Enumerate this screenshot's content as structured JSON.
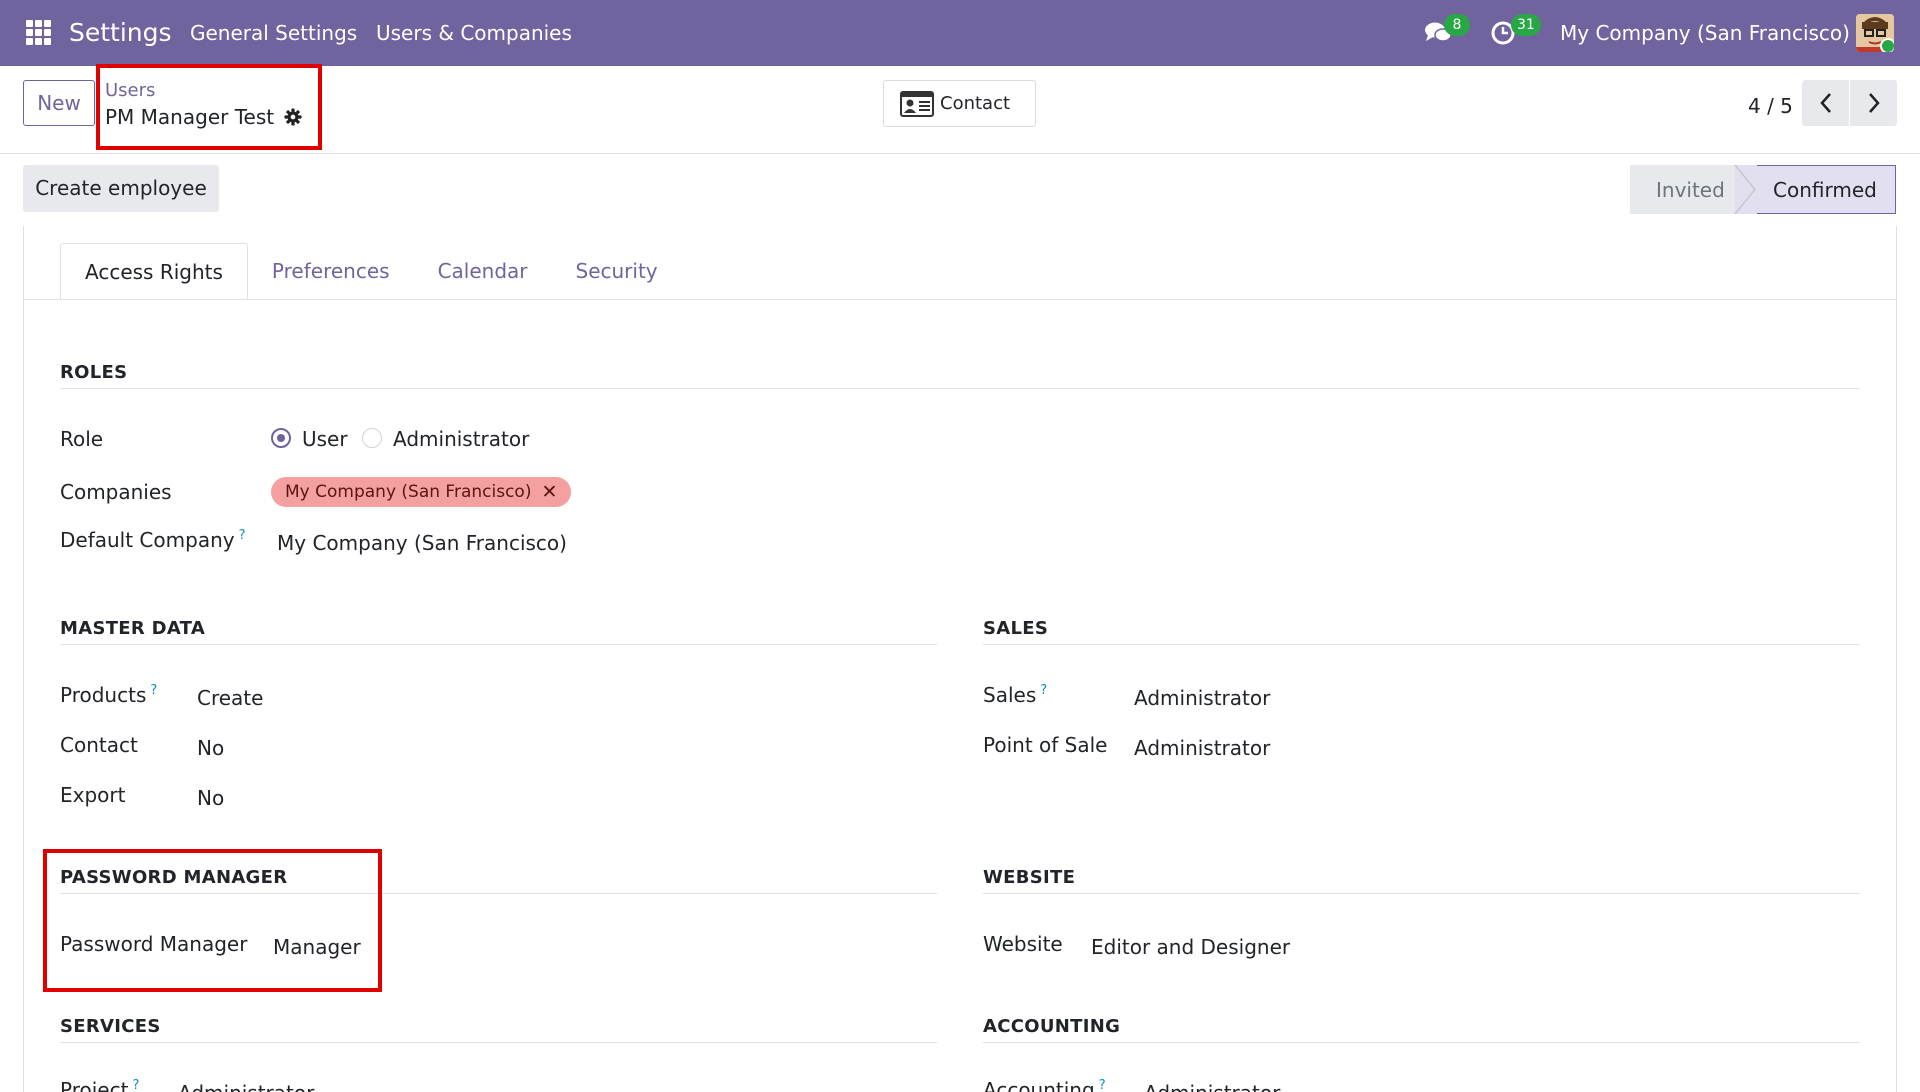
{
  "navbar": {
    "app_title": "Settings",
    "menu": [
      "General Settings",
      "Users & Companies"
    ],
    "messages_count": "8",
    "activities_count": "31",
    "company": "My Company (San Francisco)"
  },
  "control": {
    "new_label": "New",
    "breadcrumb_parent": "Users",
    "breadcrumb_current": "PM Manager Test",
    "contact_label": "Contact",
    "pager": "4 / 5"
  },
  "status": {
    "create_employee_label": "Create employee",
    "stages": [
      "Invited",
      "Confirmed"
    ],
    "active_stage": "Confirmed"
  },
  "tabs": [
    "Access Rights",
    "Preferences",
    "Calendar",
    "Security"
  ],
  "roles": {
    "title": "ROLES",
    "role_label": "Role",
    "role_options": [
      "User",
      "Administrator"
    ],
    "role_selected": "User",
    "companies_label": "Companies",
    "companies_tags": [
      "My Company (San Francisco)"
    ],
    "default_company_label": "Default Company",
    "default_company_value": "My Company (San Francisco)"
  },
  "master_data": {
    "title": "MASTER DATA",
    "rows": [
      {
        "label": "Products",
        "value": "Create",
        "help": "?"
      },
      {
        "label": "Contact",
        "value": "No"
      },
      {
        "label": "Export",
        "value": "No"
      }
    ]
  },
  "sales": {
    "title": "SALES",
    "rows": [
      {
        "label": "Sales",
        "value": "Administrator",
        "help": "?"
      },
      {
        "label": "Point of Sale",
        "value": "Administrator"
      }
    ]
  },
  "password_manager": {
    "title": "PASSWORD MANAGER",
    "rows": [
      {
        "label": "Password Manager",
        "value": "Manager"
      }
    ]
  },
  "website": {
    "title": "WEBSITE",
    "rows": [
      {
        "label": "Website",
        "value": "Editor and Designer"
      }
    ]
  },
  "services": {
    "title": "SERVICES",
    "rows": [
      {
        "label": "Project",
        "value": "Administrator",
        "help": "?"
      }
    ]
  },
  "accounting": {
    "title": "ACCOUNTING",
    "rows": [
      {
        "label": "Accounting",
        "value": "Administrator",
        "help": "?"
      }
    ]
  },
  "colors": {
    "brand": "#71639e",
    "highlight_box": "#e00000",
    "company_tag": "#f5a0a0",
    "badge": "#28a745"
  }
}
